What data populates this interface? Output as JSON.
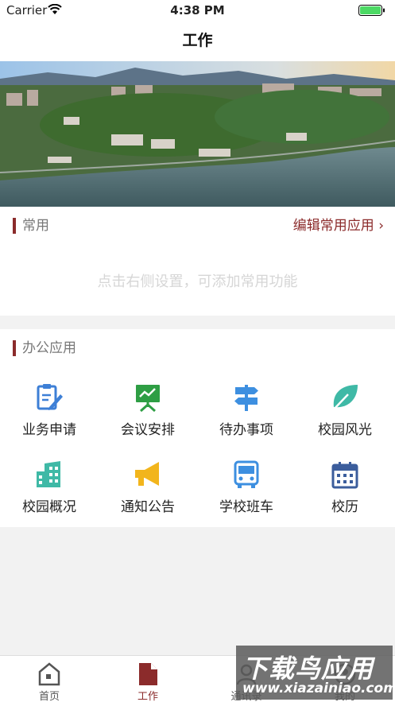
{
  "status_bar": {
    "carrier": "Carrier",
    "time": "4:38 PM"
  },
  "nav": {
    "title": "工作"
  },
  "banner": {
    "image": "campus-aerial-photo"
  },
  "common_section": {
    "title": "常用",
    "action_label": "编辑常用应用 ›",
    "placeholder": "点击右侧设置，可添加常用功能"
  },
  "office_section": {
    "title": "办公应用",
    "apps": [
      {
        "label": "业务申请",
        "icon": "edit-document-icon",
        "color": "#3d7fd6"
      },
      {
        "label": "会议安排",
        "icon": "presentation-board-icon",
        "color": "#2e9e44"
      },
      {
        "label": "待办事项",
        "icon": "signpost-icon",
        "color": "#3d8fe0"
      },
      {
        "label": "校园风光",
        "icon": "leaf-icon",
        "color": "#3fb9a6"
      },
      {
        "label": "校园概况",
        "icon": "building-icon",
        "color": "#3fb9a6"
      },
      {
        "label": "通知公告",
        "icon": "megaphone-icon",
        "color": "#f2b51c"
      },
      {
        "label": "学校班车",
        "icon": "bus-icon",
        "color": "#3d8fe0"
      },
      {
        "label": "校历",
        "icon": "calendar-icon",
        "color": "#3b5d9c"
      }
    ]
  },
  "tabbar": {
    "tabs": [
      {
        "label": "首页",
        "icon": "home-icon"
      },
      {
        "label": "工作",
        "icon": "document-icon",
        "active": true
      },
      {
        "label": "通讯录",
        "icon": "contacts-icon"
      },
      {
        "label": "我的",
        "icon": "profile-icon"
      }
    ]
  },
  "watermark": {
    "main": "下载鸟应用",
    "sub": "www.xiazainiao.com"
  },
  "colors": {
    "accent": "#8b2b2b",
    "background": "#f2f2f2"
  }
}
